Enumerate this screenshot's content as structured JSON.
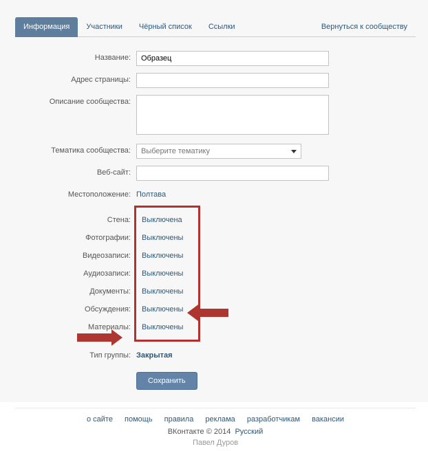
{
  "tabs": {
    "info": "Информация",
    "members": "Участники",
    "blacklist": "Чёрный список",
    "links": "Ссылки",
    "back": "Вернуться к сообществу"
  },
  "labels": {
    "name": "Название:",
    "address": "Адрес страницы:",
    "description": "Описание сообщества:",
    "theme": "Тематика сообщества:",
    "website": "Веб-сайт:",
    "location": "Местоположение:",
    "wall": "Стена:",
    "photos": "Фотографии:",
    "videos": "Видеозаписи:",
    "audios": "Аудиозаписи:",
    "docs": "Документы:",
    "discussions": "Обсуждения:",
    "materials": "Материалы:",
    "group_type": "Тип группы:"
  },
  "values": {
    "name": "Образец",
    "address": "",
    "description": "",
    "theme_placeholder": "Выберите тематику",
    "website": "",
    "location": "Полтава",
    "wall": "Выключена",
    "photos": "Выключены",
    "videos": "Выключены",
    "audios": "Выключены",
    "docs": "Выключены",
    "discussions": "Выключены",
    "materials": "Выключены",
    "group_type": "Закрытая"
  },
  "buttons": {
    "save": "Сохранить"
  },
  "footer": {
    "about": "о сайте",
    "help": "помощь",
    "rules": "правила",
    "ads": "реклама",
    "devs": "разработчикам",
    "jobs": "вакансии",
    "brand": "ВКонтакте © 2014",
    "lang": "Русский",
    "author": "Павел Дуров"
  }
}
